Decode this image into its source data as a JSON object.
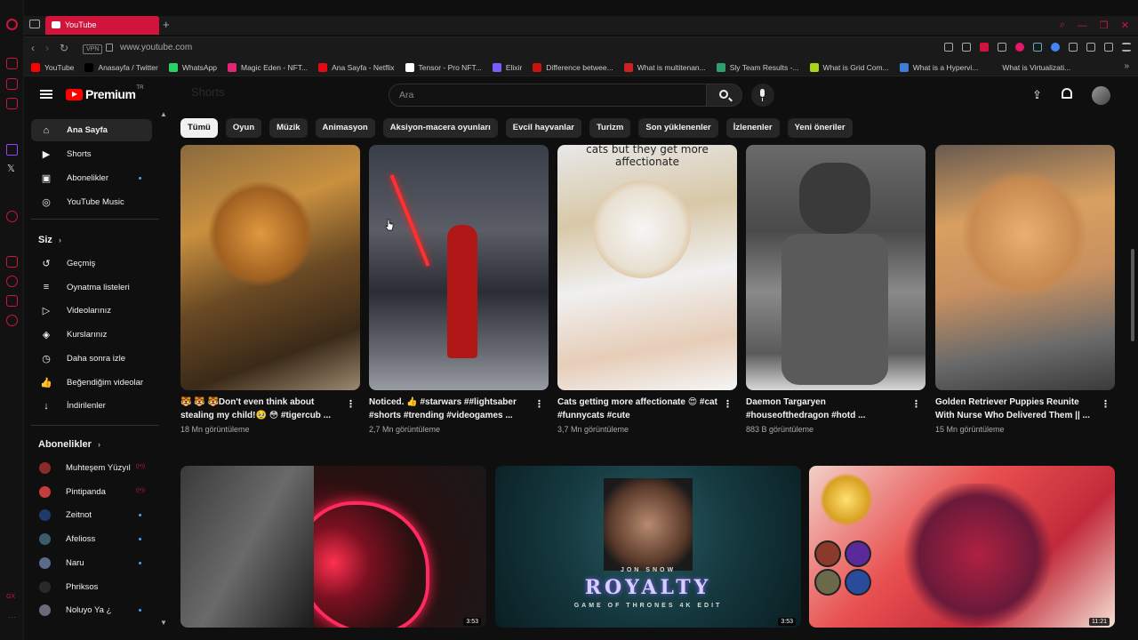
{
  "browser": {
    "tab_title": "YouTube",
    "new_tab": "+",
    "vpn_label": "VPN",
    "url": "www.youtube.com",
    "bookmarks": [
      {
        "label": "YouTube",
        "color": "#ff0000"
      },
      {
        "label": "Anasayfa / Twitter",
        "color": "#000000"
      },
      {
        "label": "WhatsApp",
        "color": "#25d366"
      },
      {
        "label": "Magic Eden - NFT...",
        "color": "#e42575"
      },
      {
        "label": "Ana Sayfa - Netflix",
        "color": "#e50914"
      },
      {
        "label": "Tensor - Pro NFT...",
        "color": "#ffffff"
      },
      {
        "label": "Elixir",
        "color": "#7b5cff"
      },
      {
        "label": "Difference betwee...",
        "color": "#cc1111"
      },
      {
        "label": "What is multitenan...",
        "color": "#cc2222"
      },
      {
        "label": "Sly Team Results -...",
        "color": "#2f9f6f"
      },
      {
        "label": "What is Grid Com...",
        "color": "#a5d41b"
      },
      {
        "label": "What is a Hypervi...",
        "color": "#3d7fd8"
      },
      {
        "label": "What is Virtualizati...",
        "color": "#1a1a1a"
      }
    ]
  },
  "header": {
    "logo_text": "Premium",
    "logo_sup": "TR",
    "ghost_title": "Shorts",
    "search_placeholder": "Ara"
  },
  "sidebar": {
    "main": [
      {
        "label": "Ana Sayfa",
        "icon": "home-icon",
        "active": true
      },
      {
        "label": "Shorts",
        "icon": "shorts-icon"
      },
      {
        "label": "Abonelikler",
        "icon": "subscriptions-icon",
        "dot": true
      },
      {
        "label": "YouTube Music",
        "icon": "youtube-music-icon"
      }
    ],
    "you_heading": "Siz",
    "you": [
      {
        "label": "Geçmiş",
        "icon": "history-icon"
      },
      {
        "label": "Oynatma listeleri",
        "icon": "playlists-icon"
      },
      {
        "label": "Videolarınız",
        "icon": "your-videos-icon"
      },
      {
        "label": "Kurslarınız",
        "icon": "courses-icon"
      },
      {
        "label": "Daha sonra izle",
        "icon": "watch-later-icon"
      },
      {
        "label": "Beğendiğim videolar",
        "icon": "liked-videos-icon"
      },
      {
        "label": "İndirilenler",
        "icon": "downloads-icon"
      }
    ],
    "subs_heading": "Abonelikler",
    "subs": [
      {
        "label": "Muhteşem Yüzyıl",
        "color": "#8a2a2a",
        "live": true
      },
      {
        "label": "Pintipanda",
        "color": "#c43c3c",
        "live": true
      },
      {
        "label": "Zeitnot",
        "color": "#1f3a6a",
        "dot": true
      },
      {
        "label": "Afelioss",
        "color": "#3b5b6b",
        "dot": true
      },
      {
        "label": "Naru",
        "color": "#5a6a8a",
        "dot": true
      },
      {
        "label": "Phriksos",
        "color": "#2a2a2a"
      },
      {
        "label": "Noluyo Ya ¿",
        "color": "#6a6a7a",
        "dot": true
      }
    ]
  },
  "chips": [
    "Tümü",
    "Oyun",
    "Müzik",
    "Animasyon",
    "Aksiyon-macera oyunları",
    "Evcil hayvanlar",
    "Turizm",
    "Son yüklenenler",
    "İzlenenler",
    "Yeni öneriler"
  ],
  "shorts": [
    {
      "title": "🐯 🐯 🐯Don't even think about stealing my child!🥹 😳 #tigercub ...",
      "views": "18 Mn görüntüleme",
      "caption": ""
    },
    {
      "title": "Noticed. 👍 #starwars ##lightsaber #shorts #trending #videogames ...",
      "views": "2,7 Mn görüntüleme",
      "caption": ""
    },
    {
      "title": "Cats getting more affectionate 😍 #cat #funnycats #cute",
      "views": "3,7 Mn görüntüleme",
      "caption": "cats but they get more affectionate"
    },
    {
      "title": "Daemon Targaryen #houseofthedragon #hotd ...",
      "views": "883 B görüntüleme",
      "caption": ""
    },
    {
      "title": "Golden Retriever Puppies Reunite With Nurse Who Delivered Them || ...",
      "views": "15 Mn görüntüleme",
      "caption": ""
    }
  ],
  "videos": [
    {
      "duration": "3:53",
      "overlay": ""
    },
    {
      "duration": "3:53",
      "top": "JON SNOW",
      "overlay": "ROYALTY",
      "bottom": "GAME OF THRONES 4K EDIT"
    },
    {
      "duration": "11:21",
      "overlay": ""
    }
  ]
}
